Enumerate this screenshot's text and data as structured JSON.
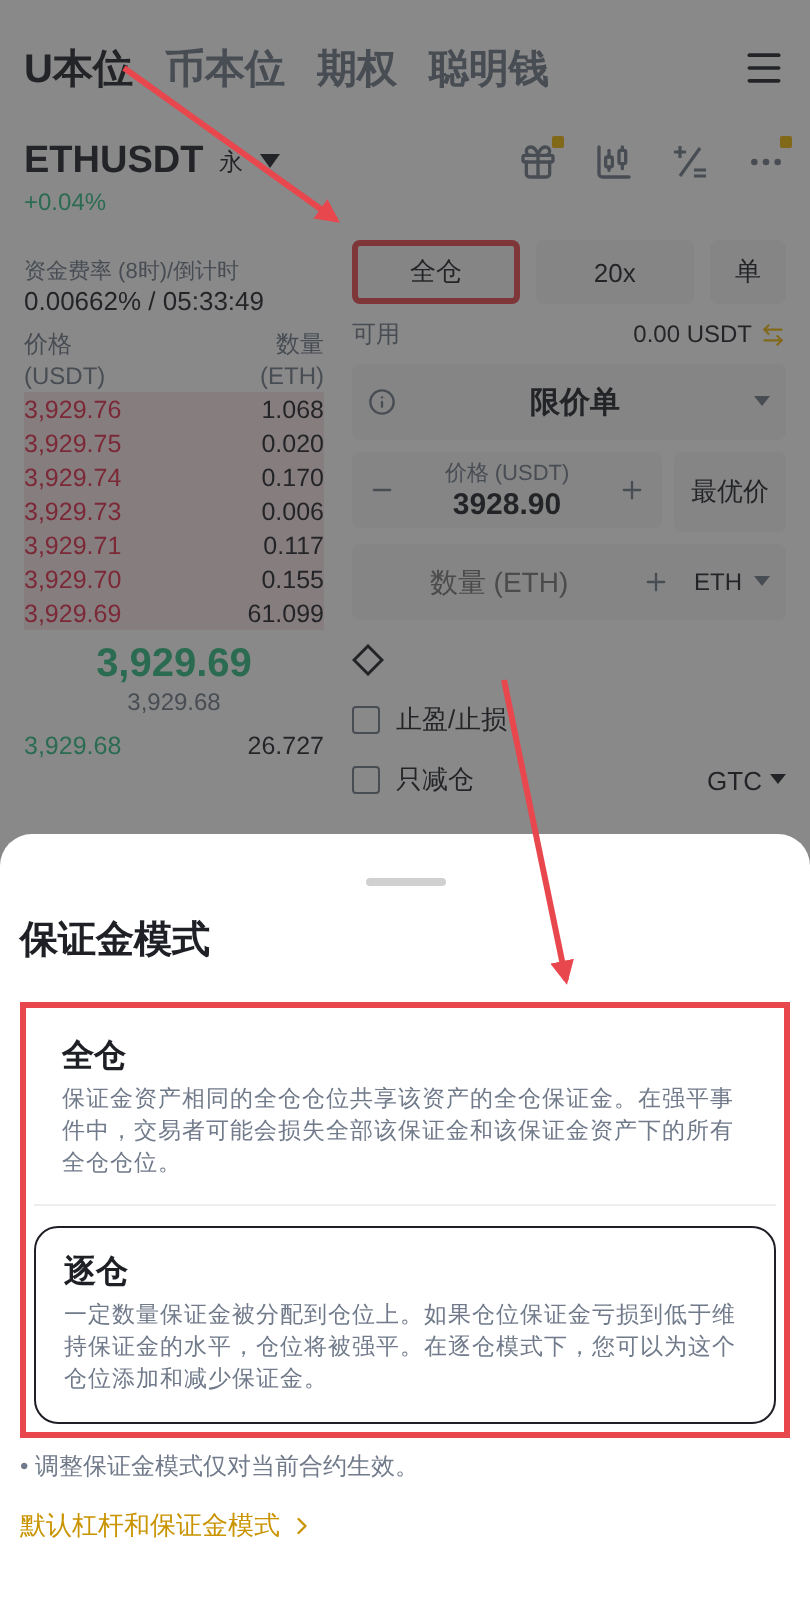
{
  "top_tabs": [
    {
      "label": "U本位",
      "selected": true
    },
    {
      "label": "币本位",
      "selected": false
    },
    {
      "label": "期权",
      "selected": false
    },
    {
      "label": "聪明钱",
      "selected": false
    }
  ],
  "pair": {
    "symbol": "ETHUSDT",
    "type": "永",
    "change": "+0.04%"
  },
  "funding": {
    "label": "资金费率 (8时)/倒计时",
    "value": "0.00662% / 05:33:49"
  },
  "margin_buttons": [
    {
      "label": "全仓",
      "kind": "mode",
      "highlighted": true
    },
    {
      "label": "20x",
      "kind": "leverage",
      "highlighted": false
    },
    {
      "label": "单",
      "kind": "position",
      "highlighted": false
    }
  ],
  "order_book": {
    "price_header": "价格",
    "price_unit": "(USDT)",
    "qty_header": "数量",
    "qty_unit": "(ETH)",
    "asks": [
      {
        "price": "3,929.76",
        "qty": "1.068"
      },
      {
        "price": "3,929.75",
        "qty": "0.020"
      },
      {
        "price": "3,929.74",
        "qty": "0.170"
      },
      {
        "price": "3,929.73",
        "qty": "0.006"
      },
      {
        "price": "3,929.71",
        "qty": "0.117"
      },
      {
        "price": "3,929.70",
        "qty": "0.155"
      },
      {
        "price": "3,929.69",
        "qty": "61.099"
      }
    ],
    "last_price": "3,929.69",
    "mark_price": "3,929.68",
    "bids": [
      {
        "price": "3,929.68",
        "qty": "26.727"
      }
    ]
  },
  "order_form": {
    "available_label": "可用",
    "available_value": "0.00 USDT",
    "order_type": "限价单",
    "price_label": "价格 (USDT)",
    "price_value": "3928.90",
    "best_price": "最优价",
    "quantity_placeholder": "数量 (ETH)",
    "quantity_unit": "ETH",
    "options": [
      {
        "label": "止盈/止损",
        "checked": false
      },
      {
        "label": "只减仓",
        "checked": false
      }
    ],
    "time_in_force": "GTC"
  },
  "sheet": {
    "title": "保证金模式",
    "highlighted": true,
    "modes": [
      {
        "title": "全仓",
        "description": "保证金资产相同的全仓仓位共享该资产的全仓保证金。在强平事件中，交易者可能会损失全部该保证金和该保证金资产下的所有全仓仓位。",
        "selected": false
      },
      {
        "title": "逐仓",
        "description": "一定数量保证金被分配到仓位上。如果仓位保证金亏损到低于维持保证金的水平，仓位将被强平。在逐仓模式下，您可以为这个仓位添加和减少保证金。",
        "selected": true
      }
    ],
    "note": "• 调整保证金模式仅对当前合约生效。",
    "link": "默认杠杆和保证金模式"
  }
}
